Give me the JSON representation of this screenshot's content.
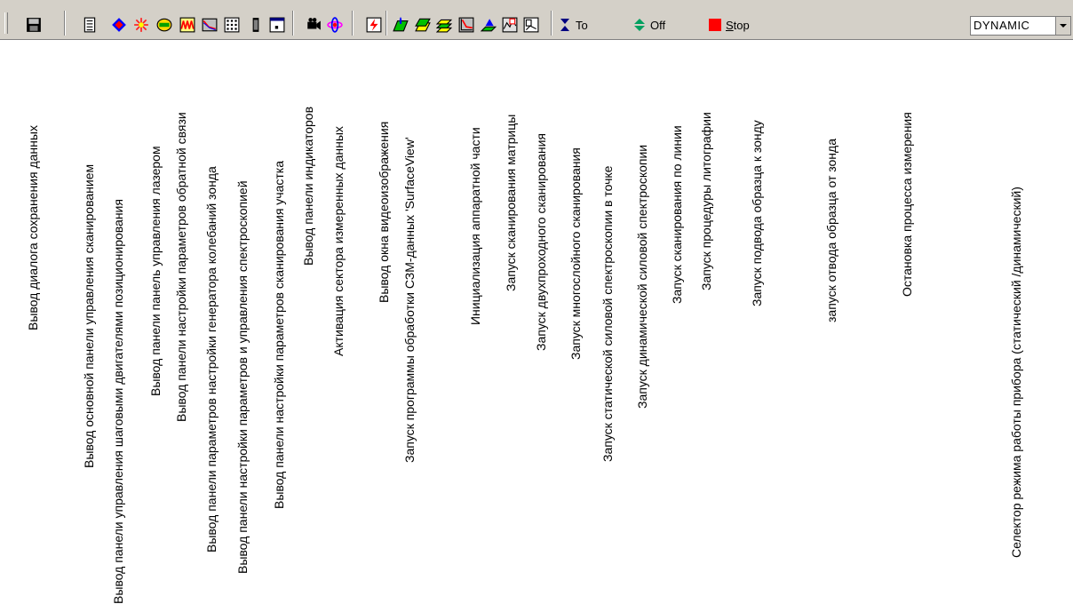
{
  "mode_select": {
    "value": "DYNAMIC"
  },
  "buttons": {
    "to": "To",
    "off": "Off",
    "stop_underlined": "S",
    "stop_rest": "top"
  },
  "labels": [
    "Вывод диалога сохранения данных",
    "Вывод основной панели управления сканированием",
    "Вывод панели управления шаговыми двигателями позиционирования",
    "Вывод панели панель управления лазером",
    "Вывод панели настройки параметров обратной связи",
    "Вывод панели параметров настройки генератора колебаний зонда",
    "Вывод панели настройки параметров и управления спектроскопией",
    "Вывод панели настройки параметров сканирования участка",
    "Вывод панели индикаторов",
    "Активация сектора измеренных данных",
    "Вывод окна видеоизображения",
    "Запуск программы обработки СЗМ-данных 'SurfaceView'",
    "Инициализация аппаратной части",
    "Запуск сканирования матрицы",
    "Запуск двухпроходного сканирования",
    "Запуск многослойного сканирования",
    "Запуск статической силовой спектроскопии в точке",
    "Запуск динамической силовой спектроскопии",
    "Запуск сканирования по линии",
    "Запуск процедуры литографии",
    "Запуск подвода образца к зонду",
    "запуск отвода образца от зонда",
    "Остановка процесса измерения",
    "Селектор режима работы прибора (статический /динамический)"
  ],
  "icons": [
    "save-icon",
    "scan-panel-icon",
    "stepper-motors-icon",
    "laser-icon",
    "feedback-icon",
    "oscillator-icon",
    "spectroscopy-icon",
    "scan-area-icon",
    "indicators-icon",
    "data-sector-icon",
    "video-icon",
    "surfaceview-icon",
    "hardware-init-icon",
    "matrix-scan-icon",
    "two-pass-scan-icon",
    "multilayer-scan-icon",
    "static-spectroscopy-icon",
    "dynamic-spectroscopy-icon",
    "line-scan-icon",
    "lithography-icon",
    "approach-icon",
    "retract-icon",
    "stop-icon",
    "dropdown-arrow-icon"
  ]
}
